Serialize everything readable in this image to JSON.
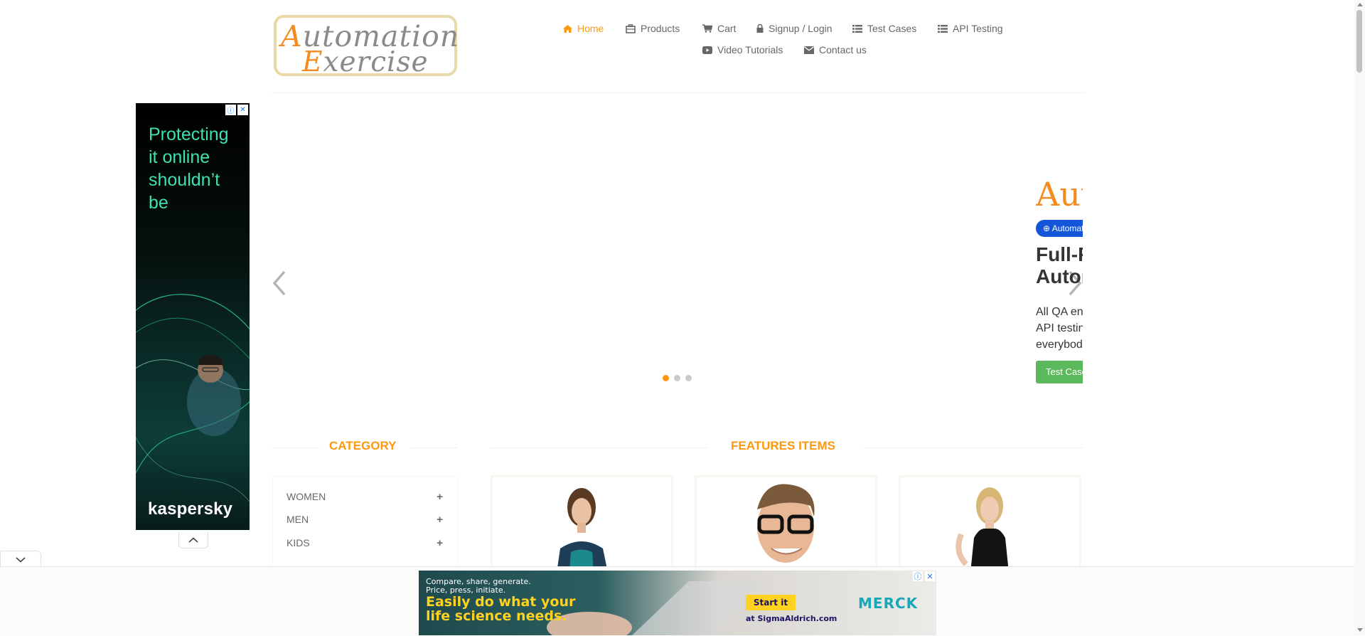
{
  "logo": {
    "line1_cap": "A",
    "line1_rest": "utomation",
    "line2_cap": "E",
    "line2_rest": "xercise"
  },
  "nav": {
    "home": "Home",
    "products": "Products",
    "cart": "Cart",
    "signup_login": "Signup / Login",
    "test_cases": "Test Cases",
    "api_testing": "API Testing",
    "video_tutorials": "Video Tutorials",
    "contact_us": "Contact us"
  },
  "ad_left": {
    "headline": "Protecting it online shouldn’t be",
    "brand": "kaspersky"
  },
  "slider": {
    "title": "Automation",
    "badge": "Automation Exercise",
    "heading_line1": "Full-Fledged practice website for",
    "heading_line2": "Automation Engineers",
    "text_line1": "All QA engineers can use this website for automation practice and",
    "text_line2": "API testing either they are at beginner or advance level. This is for",
    "text_line3": "everybody to help them brush up their automation skills.",
    "button": "Test Cases",
    "active_slide": 1,
    "slide_count": 3
  },
  "category": {
    "title": "CATEGORY",
    "items": [
      {
        "label": "WOMEN"
      },
      {
        "label": "MEN"
      },
      {
        "label": "KIDS"
      }
    ]
  },
  "features": {
    "title": "FEATURES ITEMS"
  },
  "ad_bottom": {
    "small_line1": "Compare, share, generate.",
    "small_line2": "Price, press, initiate.",
    "big_line1": "Easily do what your",
    "big_line2": "life science needs.",
    "button": "Start it",
    "site": "at SigmaAldrich.com",
    "brand": "MERCK"
  },
  "colors": {
    "accent": "#fe980f",
    "nav_text": "#696763",
    "green": "#5cb85c",
    "badge_blue": "#1455d9"
  }
}
